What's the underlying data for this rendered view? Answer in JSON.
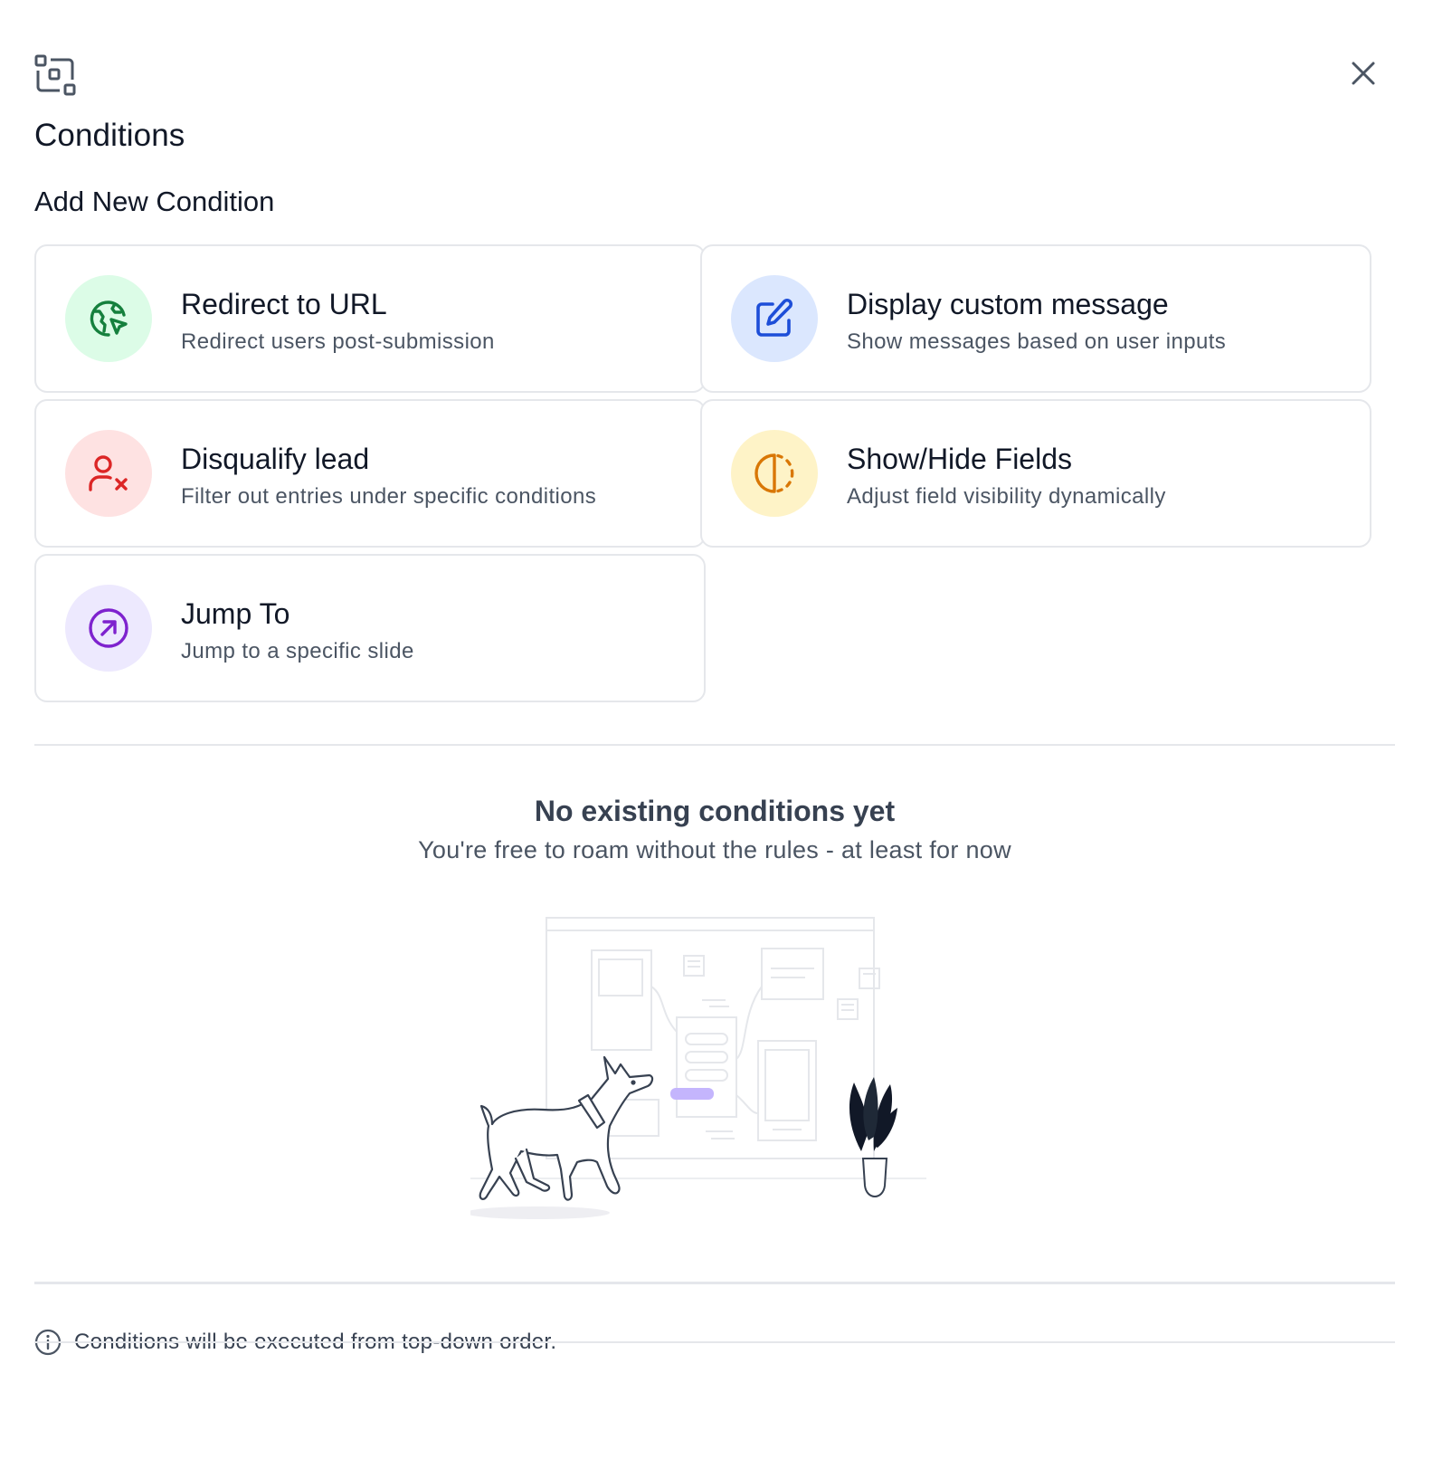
{
  "header": {
    "icon": "layout-conditions-icon",
    "title": "Conditions",
    "close_icon": "close-icon"
  },
  "add_section": {
    "heading": "Add New Condition",
    "options": [
      {
        "title": "Redirect to URL",
        "description": "Redirect users post-submission",
        "icon": "globe-cursor-icon",
        "color": "#15803d",
        "bg": "#dcfce7"
      },
      {
        "title": "Display custom message",
        "description": "Show messages based on user inputs",
        "icon": "edit-icon",
        "color": "#1d4ed8",
        "bg": "#dbe7fe"
      },
      {
        "title": "Disqualify lead",
        "description": "Filter out entries under specific conditions",
        "icon": "user-x-icon",
        "color": "#dc2626",
        "bg": "#fee2e2"
      },
      {
        "title": "Show/Hide Fields",
        "description": "Adjust field visibility dynamically",
        "icon": "half-circle-icon",
        "color": "#d97706",
        "bg": "#fef3c7"
      },
      {
        "title": "Jump To",
        "description": "Jump to a specific slide",
        "icon": "arrow-up-right-circle-icon",
        "color": "#7e22ce",
        "bg": "#f3e8ff"
      }
    ]
  },
  "empty_state": {
    "title": "No existing conditions yet",
    "description": "You're free to roam without the rules - at least for now"
  },
  "footer": {
    "icon": "info-icon",
    "note": "Conditions will be executed from top-down order."
  }
}
